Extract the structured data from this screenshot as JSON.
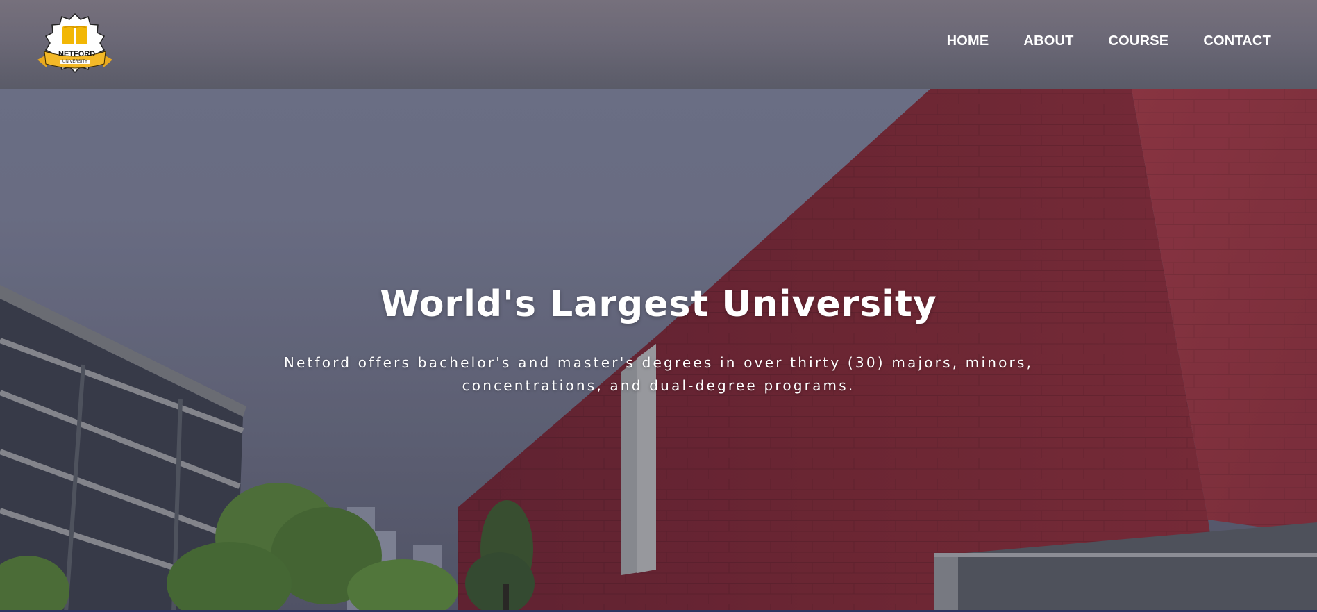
{
  "logo": {
    "icon": "book-badge-icon",
    "name": "NETFORD",
    "sub": "UNIVERSITY",
    "colors": {
      "gold": "#f2b705",
      "ribbon": "#e9b43a"
    }
  },
  "nav": {
    "items": [
      {
        "label": "HOME"
      },
      {
        "label": "ABOUT"
      },
      {
        "label": "COURSE"
      },
      {
        "label": "CONTACT"
      }
    ]
  },
  "hero": {
    "title": "World's Largest University",
    "subtitle": "Netford offers bachelor's and master's degrees in over thirty (30) majors, minors, concentrations, and dual-degree programs."
  },
  "colors": {
    "header": "#6b6876",
    "building_red": "#8a2d35",
    "text": "#ffffff"
  }
}
